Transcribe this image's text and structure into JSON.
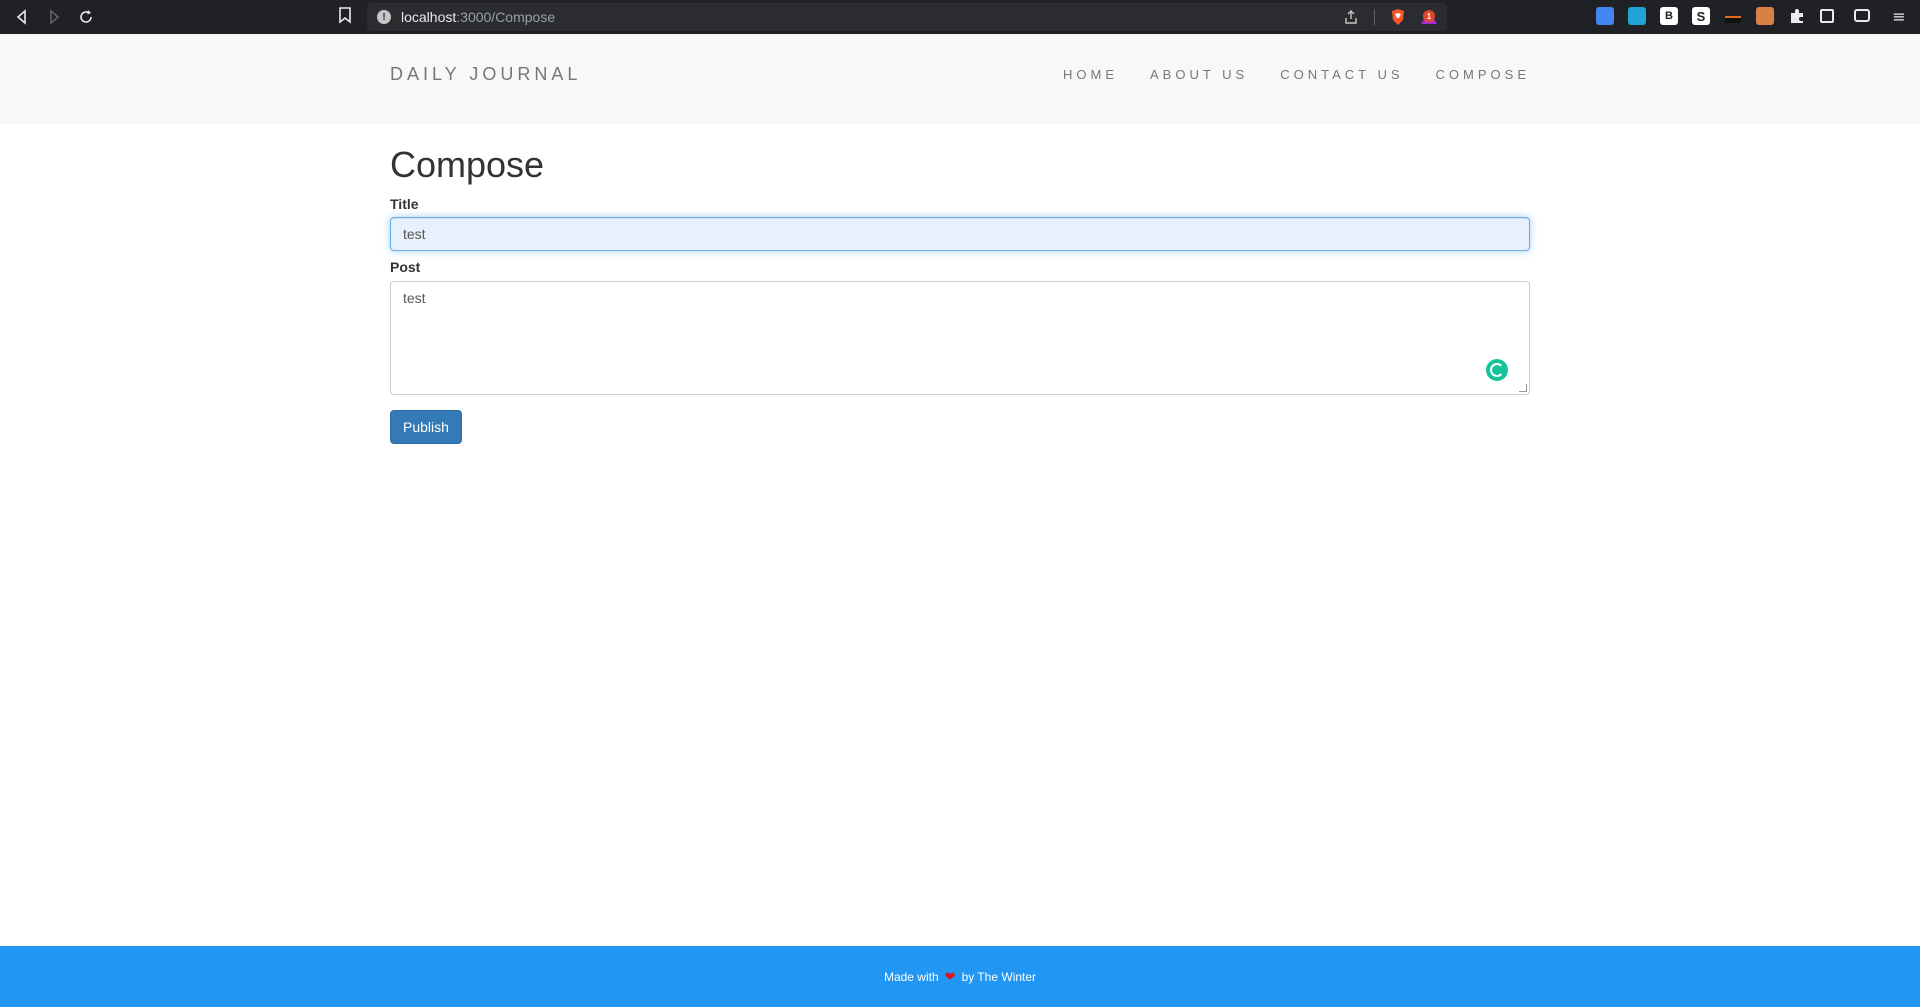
{
  "browser": {
    "url_host": "localhost",
    "url_path": ":3000/Compose",
    "rewards_badge": "1",
    "extensions": {
      "b_label": "B",
      "s_label": "S",
      "menu_glyph": "≡"
    }
  },
  "navbar": {
    "brand": "DAILY JOURNAL",
    "links": [
      "HOME",
      "ABOUT US",
      "CONTACT US",
      "COMPOSE"
    ]
  },
  "compose": {
    "heading": "Compose",
    "title_label": "Title",
    "title_value": "test",
    "post_label": "Post",
    "post_value": "test",
    "publish_label": "Publish"
  },
  "footer": {
    "made_with": "Made with",
    "heart": "❤",
    "by": "by The Winter"
  },
  "colors": {
    "footer_bg": "#2196f3",
    "publish_bg": "#337ab7",
    "navbar_bg": "#f8f8f8",
    "grammarly": "#15c39a"
  }
}
